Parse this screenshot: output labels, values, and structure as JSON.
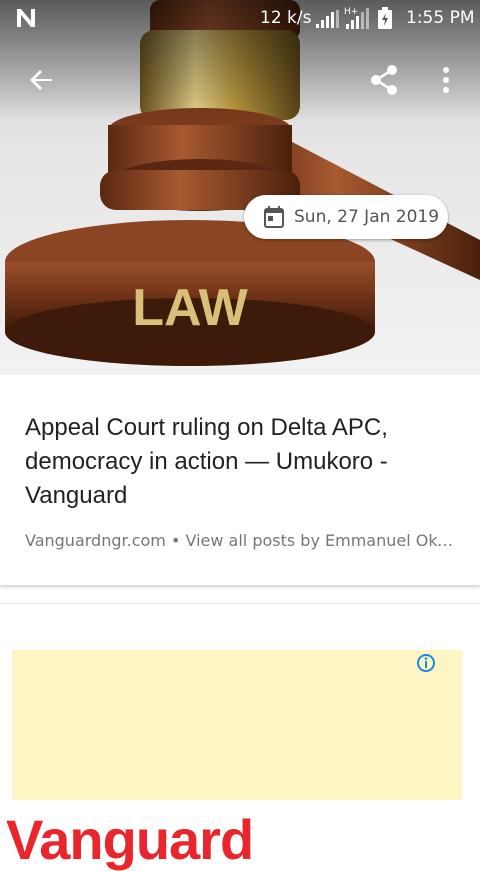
{
  "status_bar": {
    "speed": "12 k/s",
    "time": "1:55 PM",
    "network": "H+"
  },
  "hero": {
    "image_text": "LAW"
  },
  "article": {
    "date": "Sun, 27 Jan 2019",
    "headline": "Appeal Court ruling on Delta APC, democracy in action — Umukoro - Vanguard",
    "source": "Vanguardngr.com • View all posts by Emmanuel Okogba..."
  },
  "brand_text": "Vanguard",
  "colors": {
    "brand_red": "#e8262b",
    "ad_background": "#fdf6c4",
    "ad_info_blue": "#1a8ae6"
  },
  "icons": {
    "back": "arrow-back-icon",
    "share": "share-icon",
    "more": "more-vert-icon",
    "calendar": "calendar-icon",
    "info": "info-icon"
  }
}
